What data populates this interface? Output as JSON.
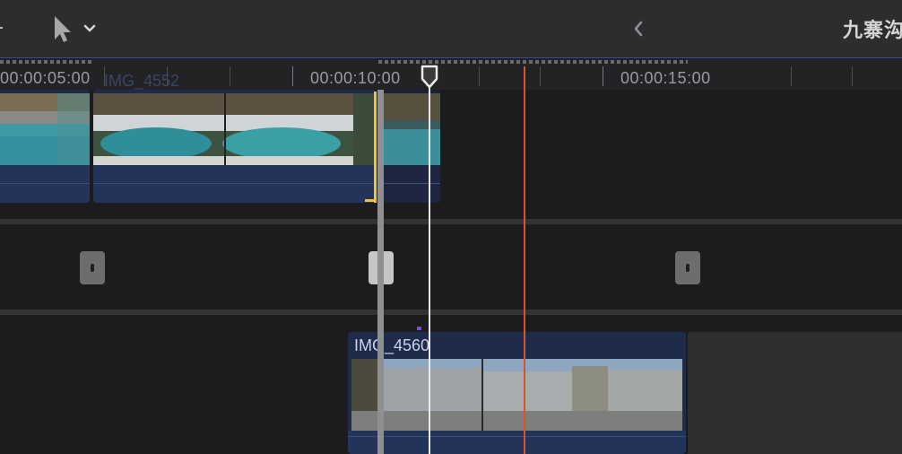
{
  "toolbar": {
    "project_title": "九寨沟",
    "select_tool_icon": "arrow-pointer-icon",
    "tool_menu_icon": "chevron-down-icon",
    "back_icon": "chevron-left-icon"
  },
  "ruler": {
    "timecodes": [
      "00:00:05:00",
      "00:00:10:00",
      "00:00:15:00"
    ]
  },
  "clips": {
    "upper_hidden_label": "IMG_4552",
    "lower_label": "IMG_4560"
  },
  "colors": {
    "clip_body": "#1e2b4a",
    "skimmer": "#d9532b",
    "playhead": "#e9e9ea",
    "trim_edge": "#f2c232",
    "accent_blue": "#3d4aa8"
  }
}
